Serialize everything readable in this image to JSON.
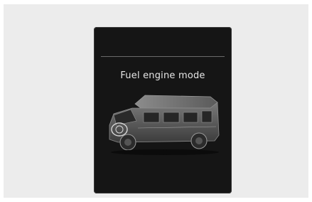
{
  "display": {
    "mode_label": "Fuel engine mode",
    "vehicle_icon": "van-icon"
  },
  "colors": {
    "background": "#ececec",
    "screen": "#151515",
    "text": "#e6e6e6"
  }
}
